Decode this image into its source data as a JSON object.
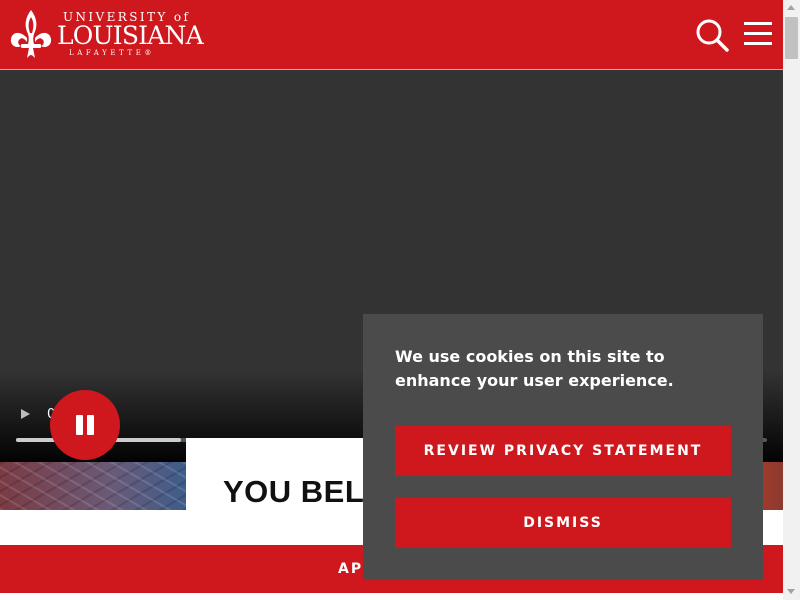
{
  "header": {
    "logo": {
      "top_line": "UNIVERSITY of",
      "main": "LOUISIANA",
      "sub": "LAFAYETTE®"
    },
    "icons": {
      "search": "search-icon",
      "menu": "menu-icon"
    }
  },
  "video": {
    "time": "0",
    "progress": 0.22,
    "play_icon": "play-icon",
    "pause_icon": "pause-icon"
  },
  "hero": {
    "title": "YOU BEL"
  },
  "apply": {
    "label": "AP"
  },
  "cookie": {
    "message": "We use cookies on this site to enhance your user experience.",
    "review_label": "REVIEW PRIVACY STATEMENT",
    "dismiss_label": "DISMISS"
  },
  "colors": {
    "brand_red": "#ce181e",
    "video_bg": "#333333",
    "cookie_bg": "#4b4b4b"
  }
}
